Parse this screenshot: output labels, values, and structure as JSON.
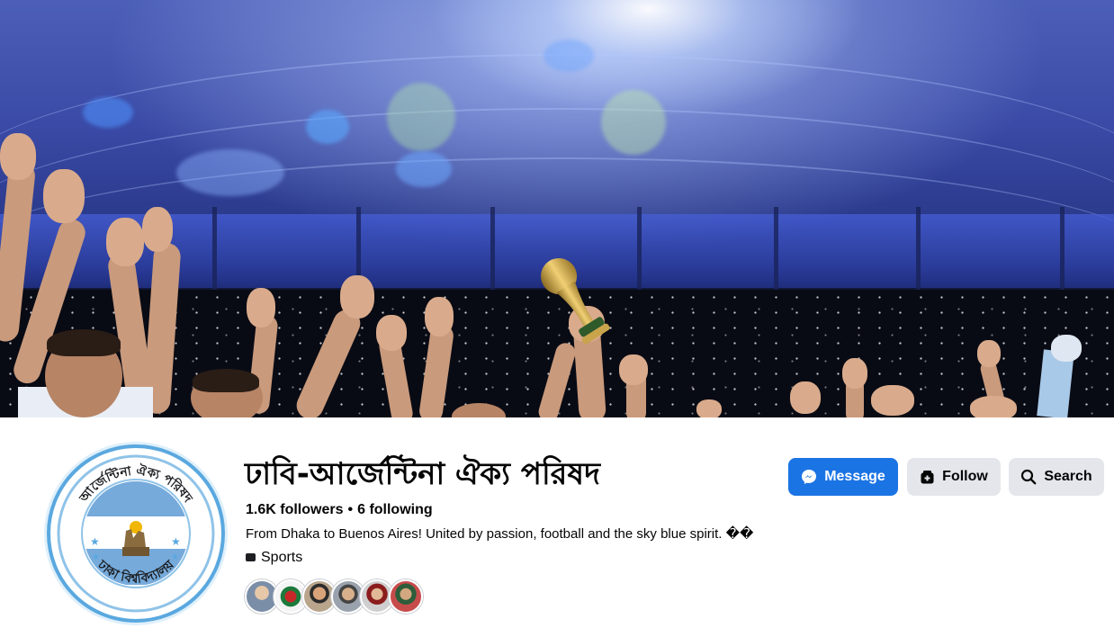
{
  "cover": {
    "description_icon": "cover-photo"
  },
  "profile": {
    "name": "ঢাবি-আর্জেন্টিনা ঐক্য পরিষদ",
    "followers": "1.6K followers",
    "following": "6 following",
    "separator": "•",
    "bio": "From Dhaka to Buenos Aires! United by passion, football and the sky blue spirit. ��",
    "category": "Sports",
    "category_icon": "briefcase-icon"
  },
  "avatar": {
    "top_text": "আর্জেন্টিনা ঐক্য পরিষদ",
    "bottom_text": "ঢাকা বিশ্ববিদ্যালয়"
  },
  "actions": {
    "message_label": "Message",
    "follow_label": "Follow",
    "search_label": "Search"
  },
  "friend_avatars": [
    "friend-1",
    "friend-2",
    "friend-3",
    "friend-4",
    "friend-5",
    "friend-6"
  ],
  "colors": {
    "primary_button": "#1b74e4",
    "secondary_button": "#e4e6eb",
    "avatar_ring": "#5aa8df",
    "sky_blue": "#75aadb"
  }
}
